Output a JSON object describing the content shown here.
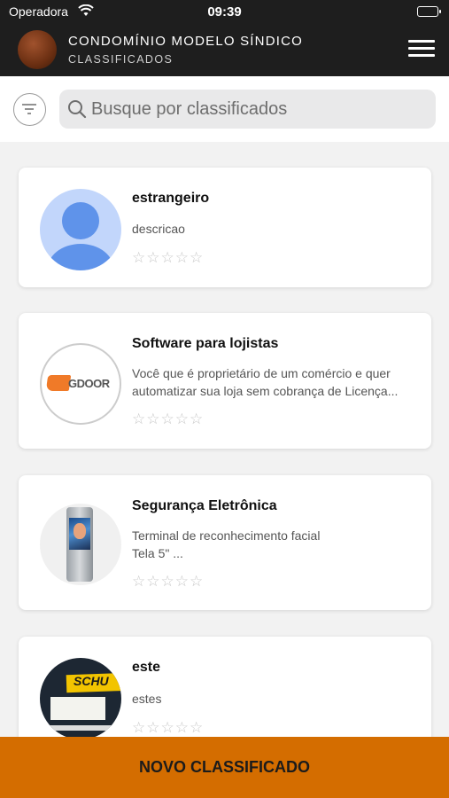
{
  "status_bar": {
    "carrier": "Operadora",
    "time": "09:39"
  },
  "header": {
    "title": "CONDOMÍNIO MODELO SÍNDICO",
    "subtitle": "CLASSIFICADOS",
    "menu_icon": "hamburger-menu-icon"
  },
  "search": {
    "placeholder": "Busque por classificados",
    "value": "",
    "filter_icon": "filter-icon",
    "search_icon": "search-icon"
  },
  "listings": [
    {
      "title": "estrangeiro",
      "description": "descricao",
      "rating": 0,
      "max_rating": 5,
      "image": "default-user-avatar"
    },
    {
      "title": "Software para lojistas",
      "description": "Você que é proprietário de um comércio e quer\nautomatizar sua loja sem cobrança de Licença...",
      "rating": 0,
      "max_rating": 5,
      "image": "gdoor-logo",
      "image_brand_text": "GDOOR"
    },
    {
      "title": "Segurança Eletrônica",
      "description": "Terminal de reconhecimento facial\nTela 5\" ...",
      "rating": 0,
      "max_rating": 5,
      "image": "facial-recognition-terminal-photo"
    },
    {
      "title": "este",
      "description": "estes",
      "rating": 0,
      "max_rating": 5,
      "image": "product-package-photo",
      "image_brand_text": "SCHU"
    }
  ],
  "footer": {
    "new_button_label": "NOVO CLASSIFICADO"
  },
  "colors": {
    "header_bg": "#1e1e1e",
    "accent": "#d46d00",
    "star_empty": "#c8c8c8",
    "avatar_blue": "#5f93ea"
  }
}
